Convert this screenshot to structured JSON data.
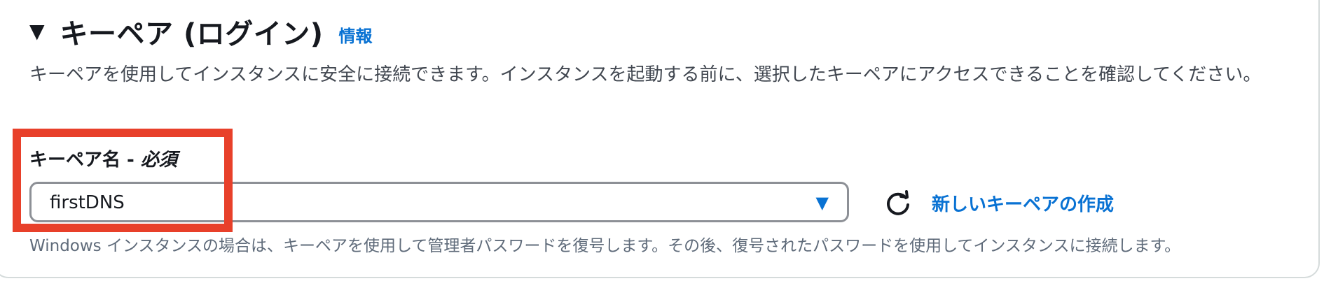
{
  "section": {
    "title": "キーペア (ログイン)",
    "info_link": "情報",
    "description": "キーペアを使用してインスタンスに安全に接続できます。インスタンスを起動する前に、選択したキーペアにアクセスできることを確認してください。"
  },
  "key_pair_field": {
    "label": "キーペア名 - ",
    "required_label": "必須",
    "selected_value": "firstDNS",
    "create_link": "新しいキーペアの作成",
    "hint": "Windows インスタンスの場合は、キーペアを使用して管理者パスワードを復号します。その後、復号されたパスワードを使用してインスタンスに接続します。"
  },
  "icons": {
    "collapse": "caret-down-icon",
    "dropdown": "dropdown-caret-icon",
    "refresh": "refresh-icon"
  },
  "colors": {
    "link": "#0972d3",
    "highlight": "#e8402a",
    "border": "#8d9096"
  }
}
